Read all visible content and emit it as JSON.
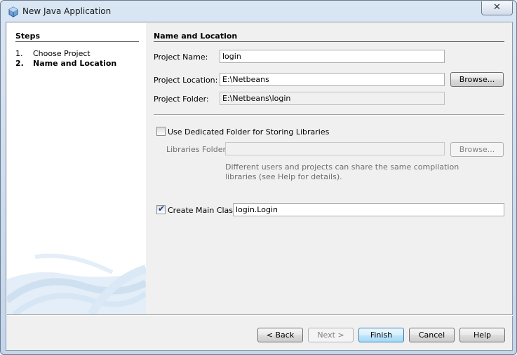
{
  "window": {
    "title": "New Java Application",
    "close_icon": "close-icon"
  },
  "steps": {
    "title": "Steps",
    "items": [
      {
        "num": "1.",
        "label": "Choose Project",
        "current": false
      },
      {
        "num": "2.",
        "label": "Name and Location",
        "current": true
      }
    ]
  },
  "name_location": {
    "title": "Name and Location",
    "project_name_label": "Project Name:",
    "project_name_value": "login",
    "project_location_label": "Project Location:",
    "project_location_value": "E:\\Netbeans",
    "browse_label": "Browse...",
    "project_folder_label": "Project Folder:",
    "project_folder_value": "E:\\Netbeans\\login",
    "dedicated_folder_label": "Use Dedicated Folder for Storing Libraries",
    "dedicated_folder_checked": false,
    "libraries_folder_label": "Libraries Folder:",
    "libraries_folder_value": "",
    "libraries_browse_label": "Browse...",
    "help_text_line1": "Different users and projects can share the same compilation",
    "help_text_line2": "libraries (see Help for details).",
    "create_main_class_label": "Create Main Class",
    "create_main_class_checked": true,
    "main_class_value": "login.Login"
  },
  "buttons": {
    "back": "< Back",
    "next": "Next >",
    "finish": "Finish",
    "cancel": "Cancel",
    "help": "Help"
  },
  "colors": {
    "title_bar": "#d9e6f4",
    "default_button": "#bee6fd",
    "checkbox_mark": "#1c3f94"
  }
}
